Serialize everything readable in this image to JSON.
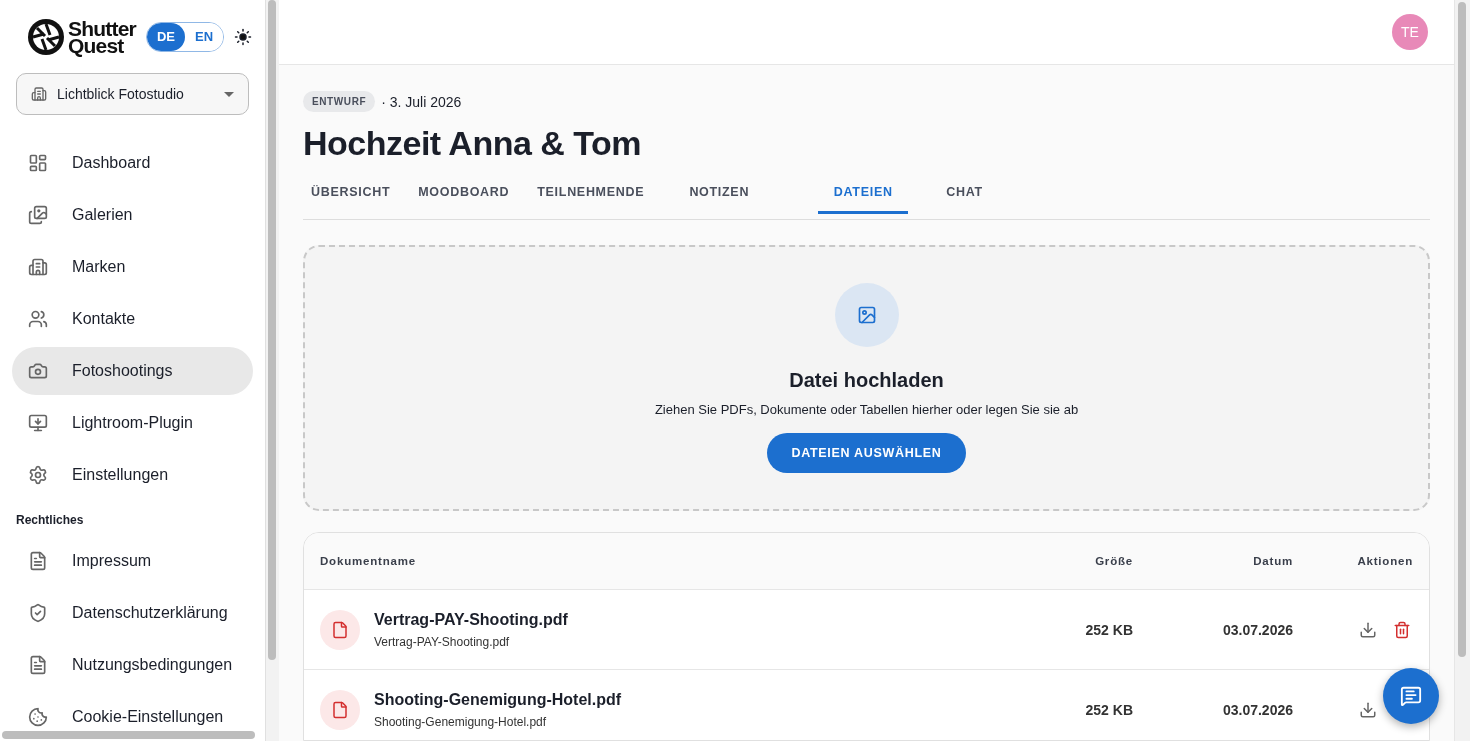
{
  "brand": {
    "line_1": "Shutter",
    "line_2": "Quest"
  },
  "languages": [
    {
      "label": "DE",
      "selected": true
    },
    {
      "label": "EN",
      "selected": false
    }
  ],
  "studio_select": {
    "value": "Lichtblick Fotostudio"
  },
  "sidebar": {
    "items": [
      {
        "label": "Dashboard",
        "selected": false
      },
      {
        "label": "Galerien",
        "selected": false
      },
      {
        "label": "Marken",
        "selected": false
      },
      {
        "label": "Kontakte",
        "selected": false
      },
      {
        "label": "Fotoshootings",
        "selected": true
      },
      {
        "label": "Lightroom-Plugin",
        "selected": false
      },
      {
        "label": "Einstellungen",
        "selected": false
      }
    ],
    "legal_heading": "Rechtliches",
    "legal_items": [
      {
        "label": "Impressum",
        "selected": false
      },
      {
        "label": "Datenschutzerklärung",
        "selected": false
      },
      {
        "label": "Nutzungsbedingungen",
        "selected": false
      },
      {
        "label": "Cookie-Einstellungen",
        "selected": false
      }
    ]
  },
  "user": {
    "initials": "TE"
  },
  "shoot": {
    "status": "ENTWURF",
    "date": "· 3. Juli 2026",
    "title": "Hochzeit Anna & Tom"
  },
  "tabs": [
    {
      "label": "ÜBERSICHT",
      "selected": false
    },
    {
      "label": "MOODBOARD",
      "selected": false
    },
    {
      "label": "TEILNEHMENDE",
      "selected": false
    },
    {
      "label": "NOTIZEN",
      "selected": false
    },
    {
      "label": "DATEIEN",
      "selected": true
    },
    {
      "label": "CHAT",
      "selected": false
    }
  ],
  "upload": {
    "title": "Datei hochladen",
    "hint": "Ziehen Sie PDFs, Dokumente oder Tabellen hierher oder legen Sie sie ab",
    "button": "DATEIEN AUSWÄHLEN"
  },
  "table": {
    "columns": [
      "Dokumentname",
      "Größe",
      "Datum",
      "Aktionen"
    ],
    "rows": [
      {
        "name": "Vertrag-PAY-Shooting.pdf",
        "filename": "Vertrag-PAY-Shooting.pdf",
        "size": "252 KB",
        "date": "03.07.2026"
      },
      {
        "name": "Shooting-Genemigung-Hotel.pdf",
        "filename": "Shooting-Genemigung-Hotel.pdf",
        "size": "252 KB",
        "date": "03.07.2026"
      }
    ]
  }
}
